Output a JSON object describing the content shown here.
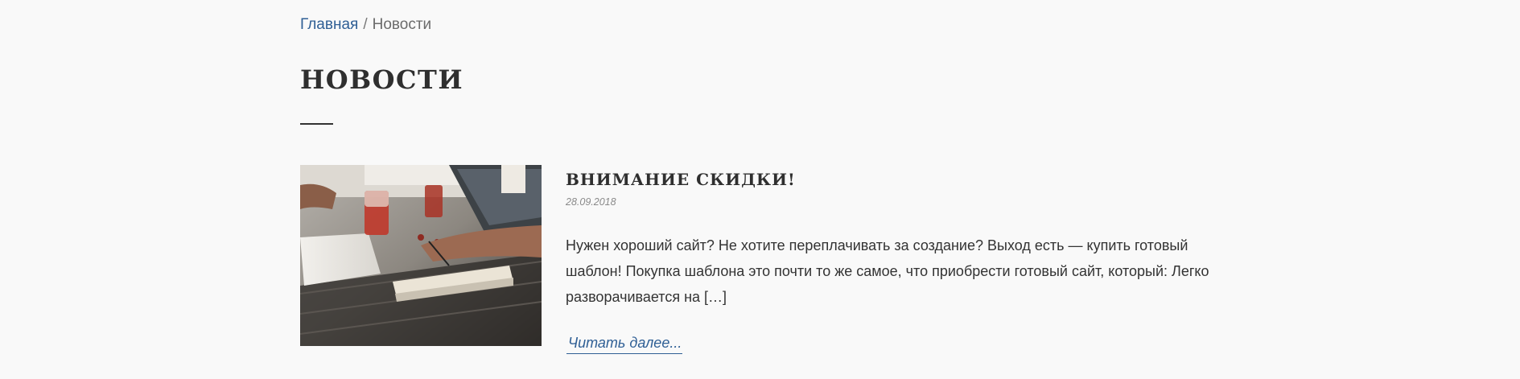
{
  "breadcrumb": {
    "home": "Главная",
    "separator": "/",
    "current": "Новости"
  },
  "page_title": "НОВОСТИ",
  "article": {
    "title": "ВНИМАНИЕ СКИДКИ!",
    "date": "28.09.2018",
    "excerpt": "Нужен хороший сайт? Не хотите переплачивать за создание? Выход есть — купить готовый шаблон! Покупка шаблона это почти то же самое, что приобрести готовый сайт, который: Легко разворачивается на […]",
    "read_more": "Читать далее..."
  },
  "colors": {
    "link": "#2f5f95",
    "heading": "#2f2f2f",
    "background": "#f9f9f9"
  }
}
